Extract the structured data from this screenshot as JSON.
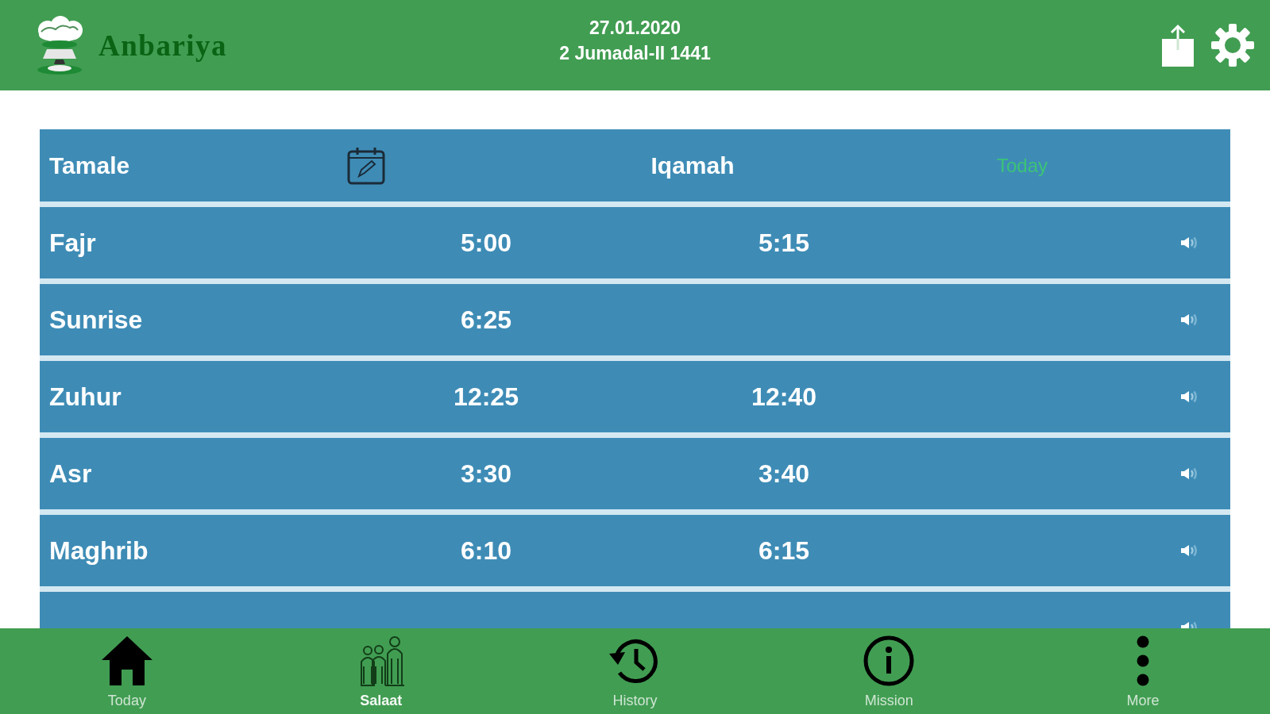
{
  "header": {
    "app_name": "Anbariya",
    "gregorian_date": "27.01.2020",
    "hijri_date": "2 Jumadal-II 1441"
  },
  "prayer_table": {
    "header": {
      "location": "Tamale",
      "iqamah_label": "Iqamah",
      "day_label": "Today"
    },
    "rows": [
      {
        "name": "Fajr",
        "time": "5:00",
        "iqamah": "5:15"
      },
      {
        "name": "Sunrise",
        "time": "6:25"
      },
      {
        "name": "Zuhur",
        "time": "12:25",
        "iqamah": "12:40"
      },
      {
        "name": "Asr",
        "time": "3:30",
        "iqamah": "3:40"
      },
      {
        "name": "Maghrib",
        "time": "6:10",
        "iqamah": "6:15"
      },
      {}
    ]
  },
  "tab_bar": [
    {
      "label": "Today",
      "kind": "home",
      "selected": false
    },
    {
      "label": "Salaat",
      "kind": "people",
      "selected": true
    },
    {
      "label": "History",
      "kind": "history",
      "selected": false
    },
    {
      "label": "Mission",
      "kind": "info",
      "selected": false
    },
    {
      "label": "More",
      "kind": "more",
      "selected": false
    }
  ]
}
